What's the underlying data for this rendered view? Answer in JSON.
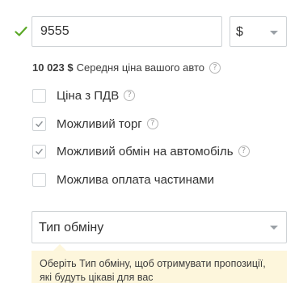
{
  "price": {
    "value": "9555",
    "currency": "$"
  },
  "average": {
    "amount": "10 023 $",
    "label": "Середня ціна вашого авто",
    "help": "?"
  },
  "options": [
    {
      "label": "Ціна з ПДВ",
      "checked": false,
      "help": "?"
    },
    {
      "label": "Можливий торг",
      "checked": true,
      "help": "?"
    },
    {
      "label": "Можливий обмін на автомобіль",
      "checked": true,
      "help": "?"
    },
    {
      "label": "Можлива оплата частинами",
      "checked": false
    }
  ],
  "exchange_type": {
    "placeholder": "Тип обміну"
  },
  "hint": {
    "text": "Оберіть Тип обміну, щоб отримувати пропозиції, які будуть цікаві для вас"
  },
  "colors": {
    "valid_check": "#5aa826",
    "hint_background": "#fdf6dc",
    "checkmark": "#8a8f94"
  }
}
